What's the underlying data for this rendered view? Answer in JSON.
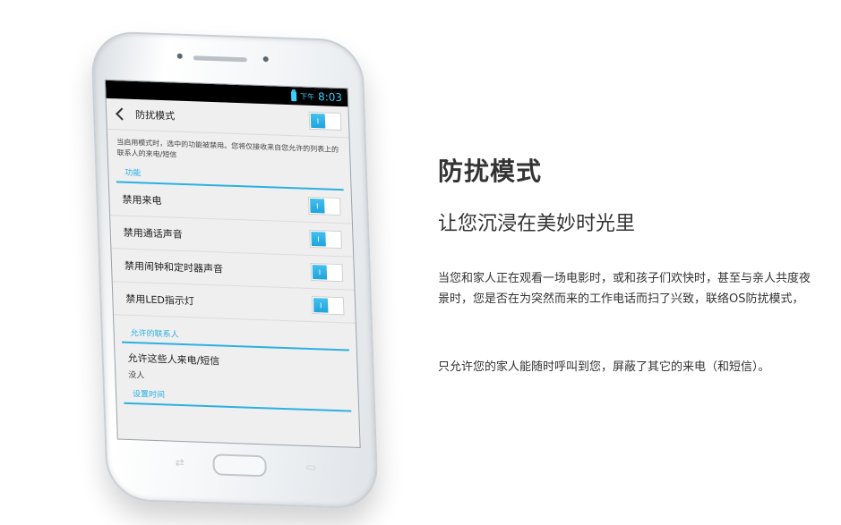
{
  "colors": {
    "accent": "#2bb0e4",
    "status_text": "#3ad1ff",
    "body_text": "#333333"
  },
  "phone": {
    "status": {
      "ampm": "下午",
      "time": "8:03"
    },
    "header": {
      "title": "防扰模式",
      "toggle_on": true
    },
    "description": "当启用模式时，选中的功能被禁用。您将仅接收来自您允许的列表上的联系人的来电/短信",
    "section_features": "功能",
    "features": [
      {
        "label": "禁用来电",
        "on": true
      },
      {
        "label": "禁用通话声音",
        "on": true
      },
      {
        "label": "禁用闹钟和定时器声音",
        "on": true
      },
      {
        "label": "禁用LED指示灯",
        "on": true
      }
    ],
    "section_contacts": "允许的联系人",
    "contacts": {
      "title": "允许这些人来电/短信",
      "value": "没人"
    },
    "section_time": "设置时间"
  },
  "content": {
    "headline": "防扰模式",
    "subhead": "让您沉浸在美妙时光里",
    "paragraph1": "当您和家人正在观看一场电影时，或和孩子们欢快时，甚至与亲人共度夜景时，您是否在为突然而来的工作电话而扫了兴致，联络OS防扰模式，",
    "paragraph2": "只允许您的家人能随时呼叫到您，屏蔽了其它的来电（和短信）。"
  }
}
